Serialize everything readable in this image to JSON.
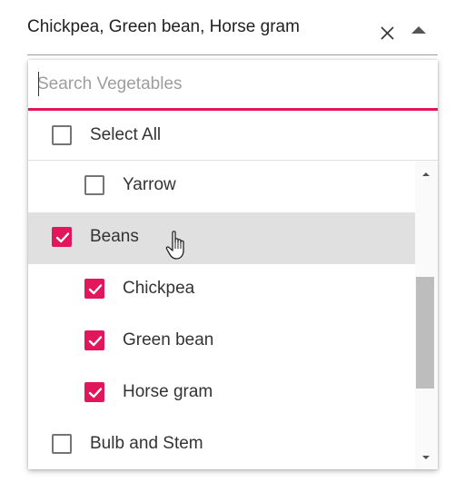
{
  "field": {
    "value": "Chickpea, Green bean, Horse gram"
  },
  "popup": {
    "search_placeholder": "Search Vegetables",
    "select_all_label": "Select All",
    "items": [
      {
        "label": "Yarrow",
        "checked": false,
        "indent": true
      },
      {
        "label": "Beans",
        "checked": true,
        "indent": false,
        "hover": true
      },
      {
        "label": "Chickpea",
        "checked": true,
        "indent": true
      },
      {
        "label": "Green bean",
        "checked": true,
        "indent": true
      },
      {
        "label": "Horse gram",
        "checked": true,
        "indent": true
      },
      {
        "label": "Bulb and Stem",
        "checked": false,
        "indent": false
      }
    ]
  },
  "colors": {
    "accent": "#e3165b",
    "hover_bg": "#e0e0e0",
    "scroll_thumb": "#bdbdbd"
  },
  "icons": {
    "clear": "close-icon",
    "caret": "caret-up-icon",
    "check": "check-icon",
    "cursor": "hand-pointer-icon"
  }
}
